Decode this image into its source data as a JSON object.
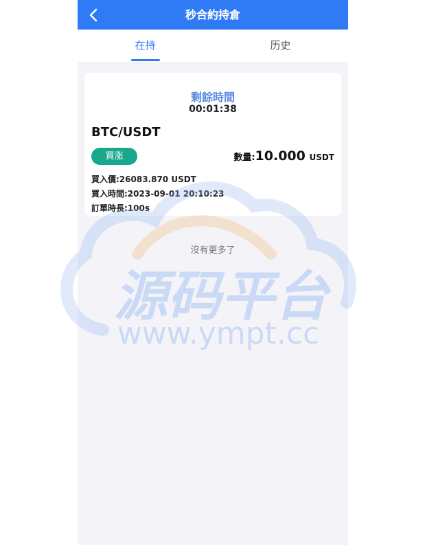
{
  "header": {
    "title": "秒合約持倉",
    "back_icon": "chevron-left-icon"
  },
  "tabs": [
    {
      "label": "在持",
      "active": true
    },
    {
      "label": "历史",
      "active": false
    }
  ],
  "order": {
    "remaining_label": "剩餘時間",
    "remaining_value": "00:01:38",
    "pair": "BTC/USDT",
    "direction_label": "買涨",
    "quantity_label": "數量:",
    "quantity_value": "10.000",
    "quantity_unit": "USDT",
    "buy_price": "買入價:26083.870 USDT",
    "buy_time": "買入時間:2023-09-01 20:10:23",
    "duration": "訂單時長:100s"
  },
  "list_end_text": "沒有更多了",
  "watermark": {
    "title": "源码平台",
    "url": "www.ympt.cc"
  },
  "colors": {
    "primary": "#2f7bf6",
    "buy_green": "#1aa88c",
    "remaining_blue": "#5b8be0",
    "background": "#f4f4f8"
  }
}
